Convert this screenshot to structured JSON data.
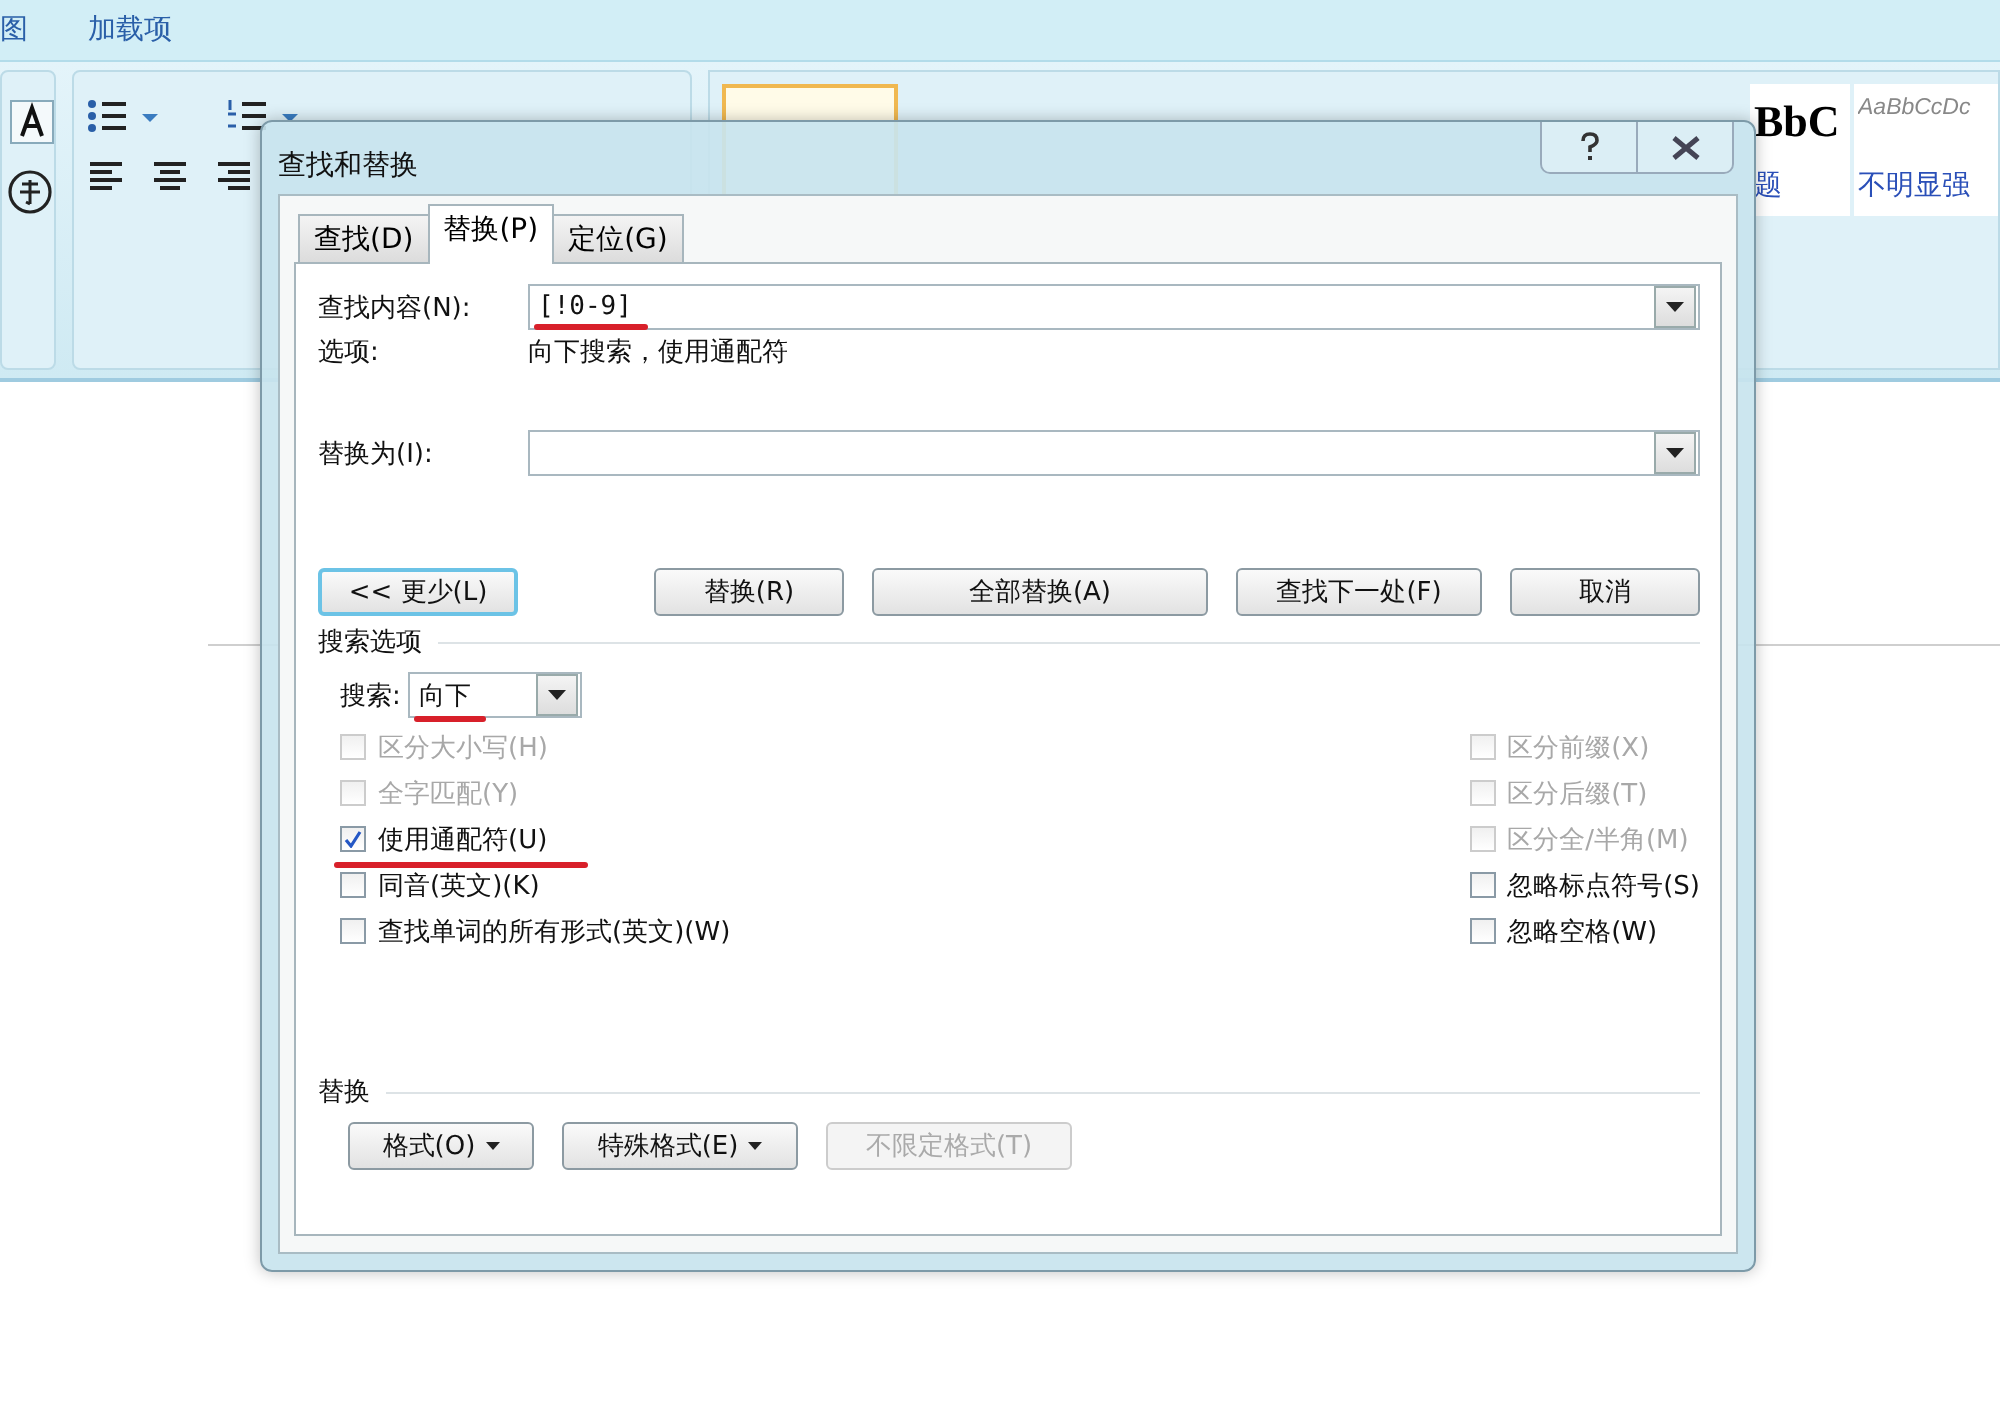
{
  "ribbon": {
    "menu_tabs": [
      "图",
      "加载项"
    ],
    "styles": [
      {
        "selected": true
      },
      {
        "preview": "BbC",
        "label": "题",
        "selected": false
      },
      {
        "preview": "AaBbCcDc",
        "label": "不明显强",
        "selected": false
      }
    ]
  },
  "dialog": {
    "title": "查找和替换",
    "tabs": [
      {
        "label": "查找(D)",
        "selected": false
      },
      {
        "label": "替换(P)",
        "selected": true
      },
      {
        "label": "定位(G)",
        "selected": false
      }
    ],
    "find": {
      "label": "查找内容(N):",
      "value": "[!0-9]",
      "underlined": true
    },
    "options": {
      "label": "选项:",
      "value": "向下搜索，使用通配符"
    },
    "replace": {
      "label": "替换为(I):"
    },
    "buttons": [
      {
        "label": "<< 更少(L)",
        "default": true
      },
      {
        "label": "替换(R)",
        "default": false
      },
      {
        "label": "全部替换(A)",
        "default": false
      },
      {
        "label": "查找下一处(F)",
        "default": false
      },
      {
        "label": "取消",
        "default": false
      }
    ],
    "search_options": {
      "title": "搜索选项",
      "search_label": "搜索:",
      "search_value": "向下",
      "underlined": true,
      "left": [
        {
          "label": "区分大小写(H)",
          "checked": false,
          "disabled": true,
          "underlined": false
        },
        {
          "label": "全字匹配(Y)",
          "checked": false,
          "disabled": true,
          "underlined": false
        },
        {
          "label": "使用通配符(U)",
          "checked": true,
          "disabled": false,
          "underlined": true
        },
        {
          "label": "同音(英文)(K)",
          "checked": false,
          "disabled": false,
          "underlined": false
        },
        {
          "label": "查找单词的所有形式(英文)(W)",
          "checked": false,
          "disabled": false,
          "underlined": false
        }
      ],
      "right": [
        {
          "label": "区分前缀(X)",
          "checked": false,
          "disabled": true,
          "underlined": false
        },
        {
          "label": "区分后缀(T)",
          "checked": false,
          "disabled": true,
          "underlined": false
        },
        {
          "label": "区分全/半角(M)",
          "checked": false,
          "disabled": true,
          "underlined": false
        },
        {
          "label": "忽略标点符号(S)",
          "checked": false,
          "disabled": false,
          "underlined": false
        },
        {
          "label": "忽略空格(W)",
          "checked": false,
          "disabled": false,
          "underlined": false
        }
      ]
    },
    "replace_section": {
      "title": "替换",
      "buttons": [
        {
          "label": "格式(O)",
          "dropdown": true,
          "disabled": false
        },
        {
          "label": "特殊格式(E)",
          "dropdown": true,
          "disabled": false
        },
        {
          "label": "不限定格式(T)",
          "dropdown": false,
          "disabled": true
        }
      ]
    }
  }
}
